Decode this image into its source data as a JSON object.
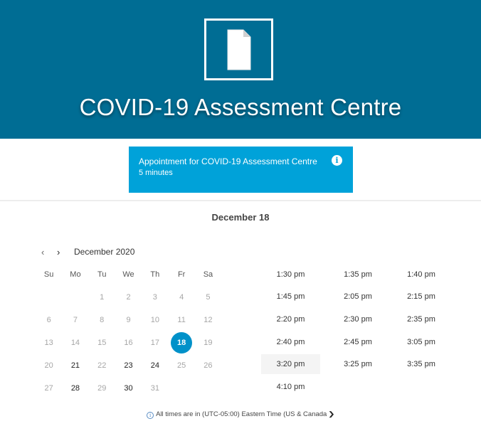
{
  "header": {
    "title": "COVID-19 Assessment Centre",
    "logo_icon": "document-icon",
    "background": "#006d94"
  },
  "service": {
    "name": "Appointment for COVID-19 Assessment Centre",
    "duration": "5 minutes",
    "info_glyph": "i",
    "color": "#00a2d9"
  },
  "selected_date_heading": "December 18",
  "calendar": {
    "prev_glyph": "‹",
    "next_glyph": "›",
    "month_label": "December 2020",
    "weekdays": [
      "Su",
      "Mo",
      "Tu",
      "We",
      "Th",
      "Fr",
      "Sa"
    ],
    "weeks": [
      [
        {
          "d": ""
        },
        {
          "d": ""
        },
        {
          "d": "1"
        },
        {
          "d": "2"
        },
        {
          "d": "3"
        },
        {
          "d": "4"
        },
        {
          "d": "5"
        }
      ],
      [
        {
          "d": "6"
        },
        {
          "d": "7"
        },
        {
          "d": "8"
        },
        {
          "d": "9"
        },
        {
          "d": "10"
        },
        {
          "d": "11"
        },
        {
          "d": "12"
        }
      ],
      [
        {
          "d": "13"
        },
        {
          "d": "14"
        },
        {
          "d": "15"
        },
        {
          "d": "16"
        },
        {
          "d": "17"
        },
        {
          "d": "18",
          "selected": true
        },
        {
          "d": "19"
        }
      ],
      [
        {
          "d": "20"
        },
        {
          "d": "21",
          "avail": true
        },
        {
          "d": "22"
        },
        {
          "d": "23",
          "avail": true
        },
        {
          "d": "24",
          "avail": true
        },
        {
          "d": "25"
        },
        {
          "d": "26"
        }
      ],
      [
        {
          "d": "27"
        },
        {
          "d": "28",
          "avail": true
        },
        {
          "d": "29"
        },
        {
          "d": "30",
          "avail": true
        },
        {
          "d": "31"
        },
        {
          "d": ""
        },
        {
          "d": ""
        }
      ]
    ],
    "selected_color": "#0091c9"
  },
  "time_slots": [
    [
      "1:30 pm",
      "1:35 pm",
      "1:40 pm"
    ],
    [
      "1:45 pm",
      "2:05 pm",
      "2:15 pm"
    ],
    [
      "2:20 pm",
      "2:30 pm",
      "2:35 pm"
    ],
    [
      "2:40 pm",
      "2:45 pm",
      "3:05 pm"
    ],
    [
      "3:20 pm",
      "3:25 pm",
      "3:35 pm"
    ],
    [
      "4:10 pm",
      "",
      ""
    ]
  ],
  "hovered_slot": "3:20 pm",
  "timezone": {
    "prefix": "All times are in",
    "zone": "(UTC-05:00) Eastern Time (US & Canada",
    "icon_glyph": "i"
  }
}
